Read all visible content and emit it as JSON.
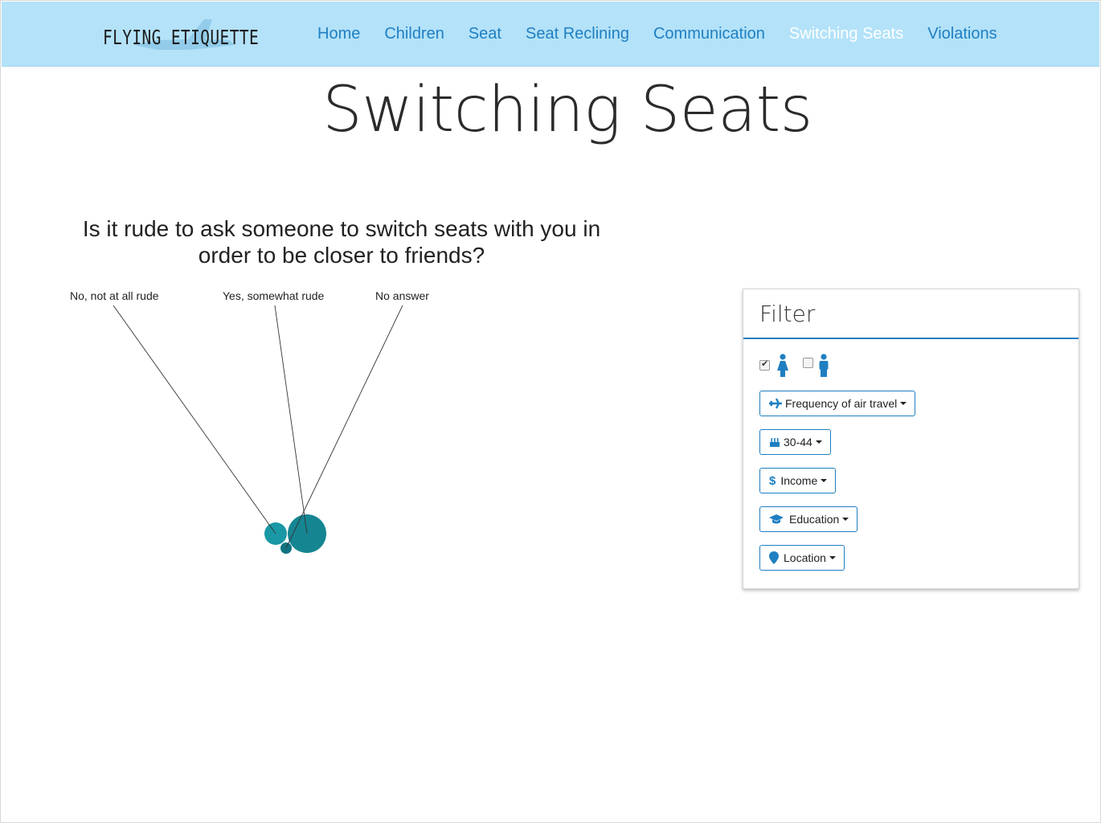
{
  "nav": {
    "logo_text": "FLYING ETIQUETTE",
    "links": [
      {
        "label": "Home",
        "active": false
      },
      {
        "label": "Children",
        "active": false
      },
      {
        "label": "Seat",
        "active": false
      },
      {
        "label": "Seat Reclining",
        "active": false
      },
      {
        "label": "Communication",
        "active": false
      },
      {
        "label": "Switching Seats",
        "active": true
      },
      {
        "label": "Violations",
        "active": false
      }
    ]
  },
  "page": {
    "title": "Switching Seats",
    "question": "Is it rude to ask someone to switch seats with you in order to be closer to friends?"
  },
  "chart_data": {
    "type": "bubble",
    "labels": [
      "No, not at all rude",
      "Yes, somewhat rude",
      "No answer"
    ],
    "title": "",
    "legend": "none",
    "grid": false
  },
  "filter": {
    "title": "Filter",
    "gender": {
      "female_checked": true,
      "male_checked": false
    },
    "buttons": [
      {
        "label": "Frequency of air travel",
        "icon": "plane-icon"
      },
      {
        "label": "30-44",
        "icon": "birthday-cake-icon"
      },
      {
        "label": "Income",
        "icon": "dollar-icon"
      },
      {
        "label": "Education",
        "icon": "graduation-cap-icon"
      },
      {
        "label": "Location",
        "icon": "map-marker-icon"
      }
    ]
  },
  "colors": {
    "navbar_bg": "#b3e2f9",
    "nav_link": "#1f7fc1",
    "nav_active": "#ffffff",
    "bubble_main": "#168592",
    "bubble_light": "#1b98a5",
    "accent": "#1f7fc1"
  }
}
